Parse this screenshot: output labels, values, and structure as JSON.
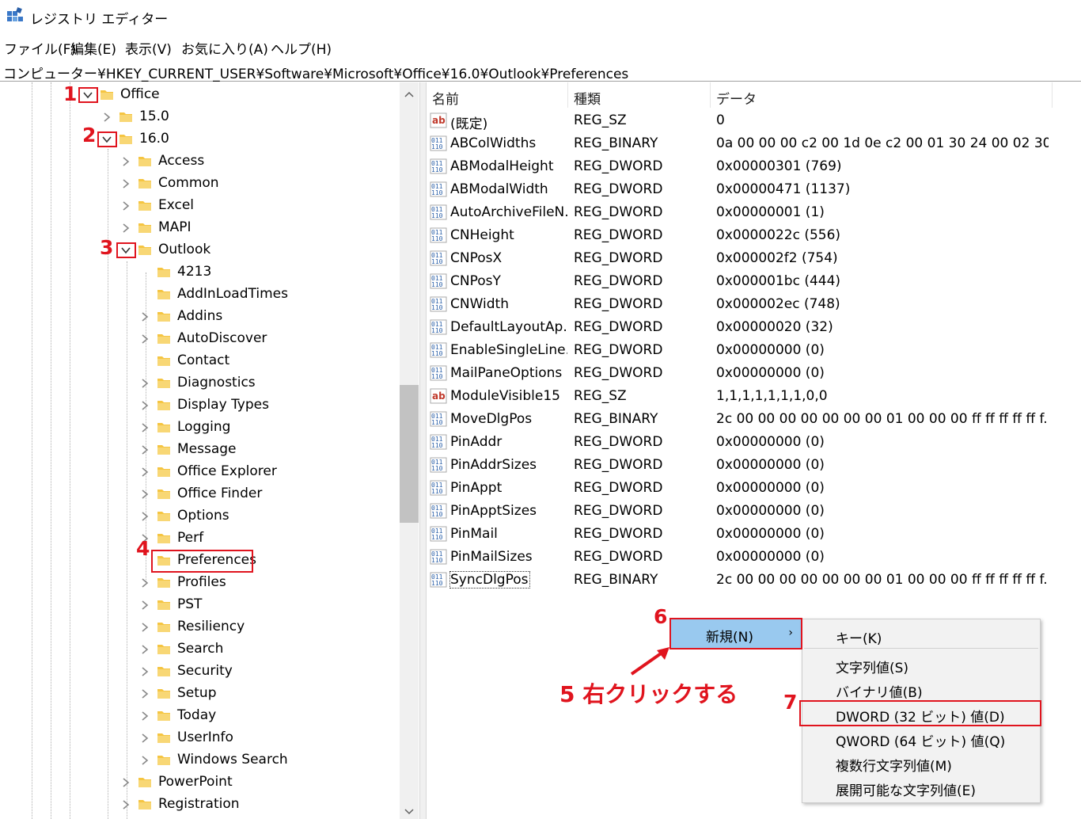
{
  "window": {
    "title": "レジストリ エディター"
  },
  "menu": [
    "ファイル(F)",
    "編集(E)",
    "表示(V)",
    "お気に入り(A)",
    "ヘルプ(H)"
  ],
  "address": "コンピューター¥HKEY_CURRENT_USER¥Software¥Microsoft¥Office¥16.0¥Outlook¥Preferences",
  "tree": [
    {
      "label": "Office"
    },
    {
      "label": "15.0"
    },
    {
      "label": "16.0"
    },
    {
      "label": "Access"
    },
    {
      "label": "Common"
    },
    {
      "label": "Excel"
    },
    {
      "label": "MAPI"
    },
    {
      "label": "Outlook"
    },
    {
      "label": "4213"
    },
    {
      "label": "AddInLoadTimes"
    },
    {
      "label": "Addins"
    },
    {
      "label": "AutoDiscover"
    },
    {
      "label": "Contact"
    },
    {
      "label": "Diagnostics"
    },
    {
      "label": "Display Types"
    },
    {
      "label": "Logging"
    },
    {
      "label": "Message"
    },
    {
      "label": "Office Explorer"
    },
    {
      "label": "Office Finder"
    },
    {
      "label": "Options"
    },
    {
      "label": "Perf"
    },
    {
      "label": "Preferences"
    },
    {
      "label": "Profiles"
    },
    {
      "label": "PST"
    },
    {
      "label": "Resiliency"
    },
    {
      "label": "Search"
    },
    {
      "label": "Security"
    },
    {
      "label": "Setup"
    },
    {
      "label": "Today"
    },
    {
      "label": "UserInfo"
    },
    {
      "label": "Windows Search"
    },
    {
      "label": "PowerPoint"
    },
    {
      "label": "Registration"
    }
  ],
  "columns": {
    "name": "名前",
    "type": "種類",
    "data": "データ"
  },
  "values": [
    {
      "icon": "ab",
      "name": "(既定)",
      "type": "REG_SZ",
      "data": "0"
    },
    {
      "icon": "bin",
      "name": "ABColWidths",
      "type": "REG_BINARY",
      "data": "0a 00 00 00 c2 00 1d 0e c2 00 01 30 24 00 02 30 c..."
    },
    {
      "icon": "bin",
      "name": "ABModalHeight",
      "type": "REG_DWORD",
      "data": "0x00000301 (769)"
    },
    {
      "icon": "bin",
      "name": "ABModalWidth",
      "type": "REG_DWORD",
      "data": "0x00000471 (1137)"
    },
    {
      "icon": "bin",
      "name": "AutoArchiveFileN...",
      "type": "REG_DWORD",
      "data": "0x00000001 (1)"
    },
    {
      "icon": "bin",
      "name": "CNHeight",
      "type": "REG_DWORD",
      "data": "0x0000022c (556)"
    },
    {
      "icon": "bin",
      "name": "CNPosX",
      "type": "REG_DWORD",
      "data": "0x000002f2 (754)"
    },
    {
      "icon": "bin",
      "name": "CNPosY",
      "type": "REG_DWORD",
      "data": "0x000001bc (444)"
    },
    {
      "icon": "bin",
      "name": "CNWidth",
      "type": "REG_DWORD",
      "data": "0x000002ec (748)"
    },
    {
      "icon": "bin",
      "name": "DefaultLayoutAp...",
      "type": "REG_DWORD",
      "data": "0x00000020 (32)"
    },
    {
      "icon": "bin",
      "name": "EnableSingleLine...",
      "type": "REG_DWORD",
      "data": "0x00000000 (0)"
    },
    {
      "icon": "bin",
      "name": "MailPaneOptions",
      "type": "REG_DWORD",
      "data": "0x00000000 (0)"
    },
    {
      "icon": "ab",
      "name": "ModuleVisible15",
      "type": "REG_SZ",
      "data": "1,1,1,1,1,1,1,0,0"
    },
    {
      "icon": "bin",
      "name": "MoveDlgPos",
      "type": "REG_BINARY",
      "data": "2c 00 00 00 00 00 00 00 01 00 00 00 ff ff ff ff ff f..."
    },
    {
      "icon": "bin",
      "name": "PinAddr",
      "type": "REG_DWORD",
      "data": "0x00000000 (0)"
    },
    {
      "icon": "bin",
      "name": "PinAddrSizes",
      "type": "REG_DWORD",
      "data": "0x00000000 (0)"
    },
    {
      "icon": "bin",
      "name": "PinAppt",
      "type": "REG_DWORD",
      "data": "0x00000000 (0)"
    },
    {
      "icon": "bin",
      "name": "PinApptSizes",
      "type": "REG_DWORD",
      "data": "0x00000000 (0)"
    },
    {
      "icon": "bin",
      "name": "PinMail",
      "type": "REG_DWORD",
      "data": "0x00000000 (0)"
    },
    {
      "icon": "bin",
      "name": "PinMailSizes",
      "type": "REG_DWORD",
      "data": "0x00000000 (0)"
    },
    {
      "icon": "bin",
      "name": "SyncDlgPos",
      "type": "REG_BINARY",
      "data": "2c 00 00 00 00 00 00 00 01 00 00 00 ff ff ff ff ff f..."
    }
  ],
  "context_menu": {
    "new_label": "新規(N)"
  },
  "submenu": [
    "キー(K)",
    "文字列値(S)",
    "バイナリ値(B)",
    "DWORD (32 ビット) 値(D)",
    "QWORD (64 ビット) 値(Q)",
    "複数行文字列値(M)",
    "展開可能な文字列値(E)"
  ],
  "annotations": {
    "steps": [
      "1",
      "2",
      "3",
      "4",
      "6",
      "7"
    ],
    "right_click": "5 右クリックする"
  },
  "colors": {
    "highlight": "#e0141e",
    "menu_hover": "#99c9ef",
    "folder": "#f5c542"
  }
}
